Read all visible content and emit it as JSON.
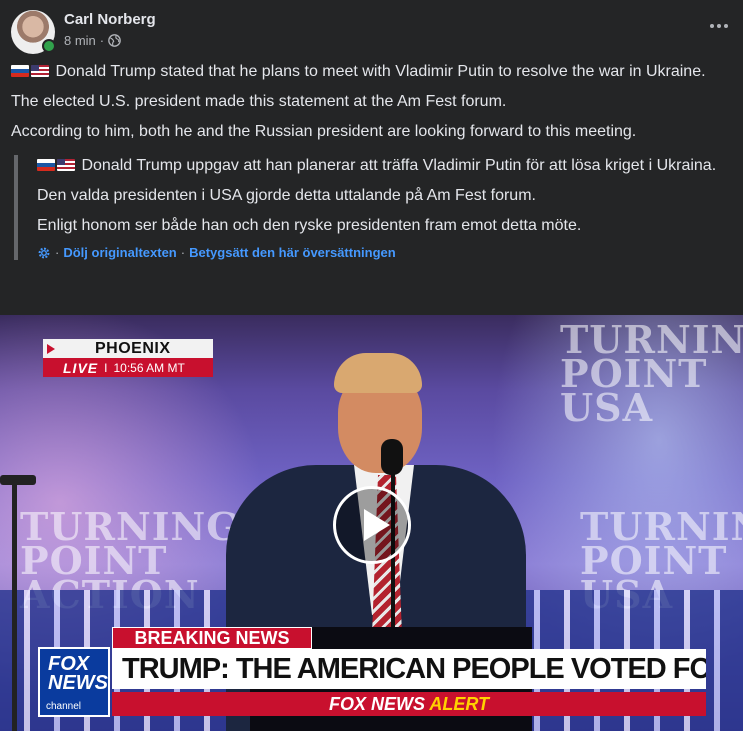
{
  "post": {
    "author": "Carl Norberg",
    "time": "8 min",
    "meta_separator": "·",
    "paragraphs": [
      "Donald Trump stated that he plans to meet with Vladimir Putin to resolve the war in Ukraine.",
      "The elected U.S. president made this statement at the Am Fest forum.",
      "According to him, both he and the Russian president are looking forward to this meeting."
    ]
  },
  "translation": {
    "paragraphs": [
      "Donald Trump uppgav att han planerar att träffa Vladimir Putin för att lösa kriget i Ukraina.",
      "Den valda presidenten i USA gjorde detta uttalande på Am Fest forum.",
      "Enligt honom ser både han och den ryske presidenten fram emot detta möte."
    ],
    "separator": "·",
    "hide_original_link": "Dölj originaltexten",
    "rate_translation_link": "Betygsätt den här översättningen"
  },
  "video": {
    "location_city": "PHOENIX",
    "live_label": "LIVE",
    "live_separator": "I",
    "time": "10:56 AM MT",
    "stage_left_text": "TURNING POINT ACTION",
    "stage_right_text": "TURNING POINT USA",
    "breaking_label": "BREAKING NEWS",
    "headline": "TRUMP: THE AMERICAN PEOPLE VOTED FOR CHANGE",
    "alert_prefix": "FOX NEWS",
    "alert_word": "ALERT",
    "logo_text": "FOX NEWS",
    "logo_sub": "channel"
  },
  "icons": {
    "globe": "globe-icon",
    "gear": "gear-icon",
    "more": "more-horizontal-icon",
    "play": "play-icon",
    "flag_ru": "russia-flag-icon",
    "flag_us": "usa-flag-icon"
  },
  "colors": {
    "background": "#242526",
    "text": "#e4e6eb",
    "secondary": "#b0b3b8",
    "link": "#4599ff",
    "online": "#31a24c",
    "fox_red": "#c8102e",
    "alert_yellow": "#ffd200"
  }
}
